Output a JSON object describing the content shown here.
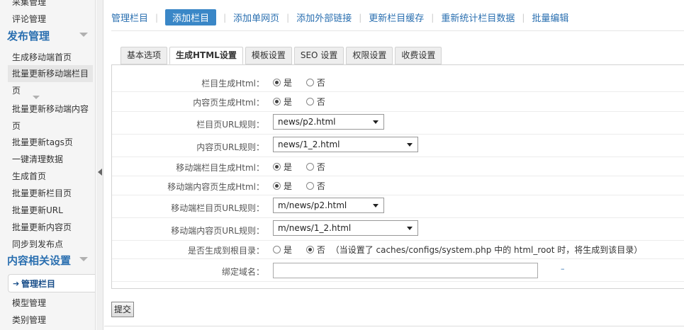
{
  "sidebar": {
    "items_top": [
      "采集管理",
      "评论管理"
    ],
    "section1": "发布管理",
    "items1": [
      "生成移动端首页",
      "批量更新移动端栏目页",
      "批量更新移动端内容页",
      "批量更新tags页",
      "一键清理数据",
      "生成首页",
      "批量更新栏目页",
      "批量更新URL",
      "批量更新内容页",
      "同步到发布点"
    ],
    "section2": "内容相关设置",
    "active": "管理栏目",
    "items2": [
      "模型管理",
      "类别管理"
    ]
  },
  "topnav": [
    "管理栏目",
    "添加栏目",
    "添加单网页",
    "添加外部链接",
    "更新栏目缓存",
    "重新统计栏目数据",
    "批量编辑"
  ],
  "tabs": [
    "基本选项",
    "生成HTML设置",
    "模板设置",
    "SEO 设置",
    "权限设置",
    "收费设置"
  ],
  "form": {
    "cat_html_label": "栏目生成Html：",
    "content_html_label": "内容页生成Html：",
    "cat_url_label": "栏目页URL规则：",
    "cat_url_value": "news/p2.html",
    "content_url_label": "内容页URL规则：",
    "content_url_value": "news/1_2.html",
    "m_cat_html_label": "移动端栏目生成Html：",
    "m_content_html_label": "移动端内容页生成Html：",
    "m_cat_url_label": "移动端栏目页URL规则：",
    "m_cat_url_value": "m/news/p2.html",
    "m_content_url_label": "移动端内容页URL规则：",
    "m_content_url_value": "m/news/1_2.html",
    "root_label": "是否生成到根目录：",
    "root_note": "（当设置了 caches/configs/system.php 中的 html_root 时，将生成到该目录）",
    "domain_label": "绑定域名：",
    "domain_value": "",
    "yes": "是",
    "no": "否",
    "tiny_link": "–"
  },
  "submit_label": "提交"
}
